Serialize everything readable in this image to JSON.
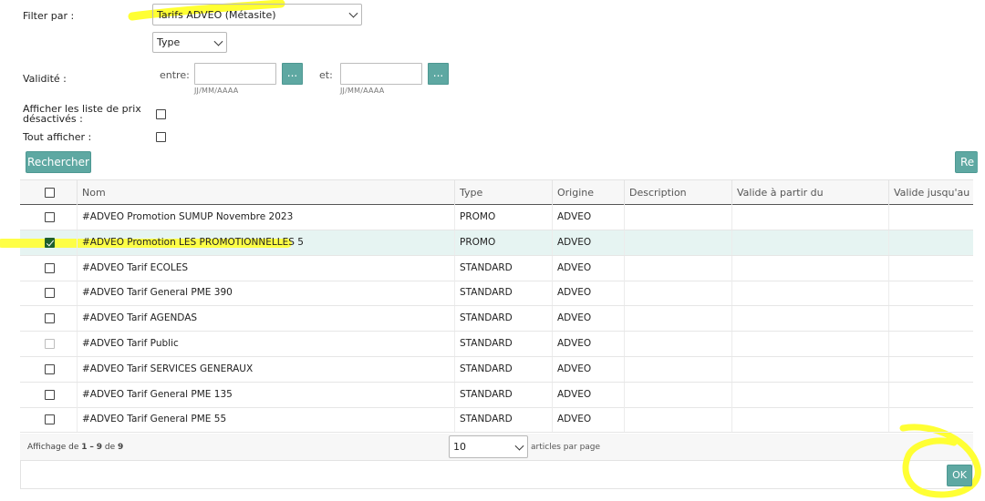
{
  "filter": {
    "label": "Filter par :",
    "primary_value": "Tarifs ADVEO (Métasite)",
    "type_value": "Type"
  },
  "validity": {
    "label": "Validité :",
    "between_label": "entre:",
    "and_label": "et:",
    "date_hint": "JJ/MM/AAAA",
    "picker_label": "..."
  },
  "options": {
    "show_disabled_line1": "Afficher les liste de prix",
    "show_disabled_line2": "désactivés :",
    "show_all_label": "Tout afficher :"
  },
  "actions": {
    "search_label": "Rechercher",
    "reset_partial_label": "Re",
    "ok_label": "OK"
  },
  "table": {
    "columns": [
      "Nom",
      "Type",
      "Origine",
      "Description",
      "Valide à partir du",
      "Valide jusqu'au"
    ],
    "rows": [
      {
        "name": "#ADVEO Promotion SUMUP Novembre 2023",
        "type": "PROMO",
        "origin": "ADVEO",
        "checked": false,
        "disabled": false
      },
      {
        "name": "#ADVEO Promotion LES PROMOTIONNELLES 5",
        "type": "PROMO",
        "origin": "ADVEO",
        "checked": true,
        "disabled": false
      },
      {
        "name": "#ADVEO Tarif ECOLES",
        "type": "STANDARD",
        "origin": "ADVEO",
        "checked": false,
        "disabled": false
      },
      {
        "name": "#ADVEO Tarif General PME 390",
        "type": "STANDARD",
        "origin": "ADVEO",
        "checked": false,
        "disabled": false
      },
      {
        "name": "#ADVEO Tarif AGENDAS",
        "type": "STANDARD",
        "origin": "ADVEO",
        "checked": false,
        "disabled": false
      },
      {
        "name": "#ADVEO Tarif Public",
        "type": "STANDARD",
        "origin": "ADVEO",
        "checked": false,
        "disabled": true
      },
      {
        "name": "#ADVEO Tarif SERVICES GENERAUX",
        "type": "STANDARD",
        "origin": "ADVEO",
        "checked": false,
        "disabled": false
      },
      {
        "name": "#ADVEO Tarif General PME 135",
        "type": "STANDARD",
        "origin": "ADVEO",
        "checked": false,
        "disabled": false
      },
      {
        "name": "#ADVEO Tarif General PME 55",
        "type": "STANDARD",
        "origin": "ADVEO",
        "checked": false,
        "disabled": false
      }
    ]
  },
  "pagination": {
    "display_prefix": "Affichage de",
    "range_start": "1",
    "range_sep": "–",
    "range_end": "9",
    "of_label": "de",
    "total": "9",
    "page_size": "10",
    "per_page_label": "articles par page"
  },
  "colors": {
    "accent": "#5ea8a2",
    "highlight": "#ffff33",
    "selected_row": "#e6f4f2"
  }
}
